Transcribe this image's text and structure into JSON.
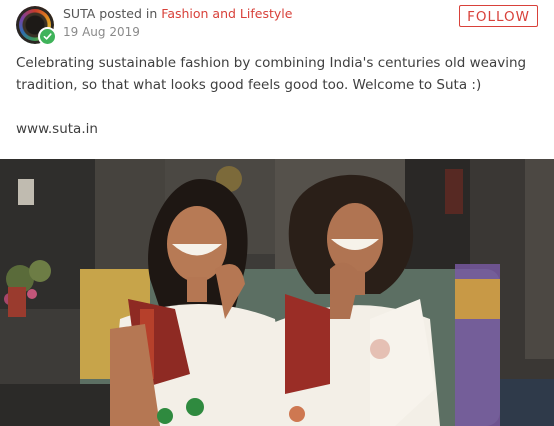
{
  "post": {
    "author": "SUTA",
    "posted_in": "posted in",
    "category": "Fashion and Lifestyle",
    "date": "19 Aug 2019",
    "follow_label": "FOLLOW",
    "description": "Celebrating sustainable fashion by combining India's centuries old weaving tradition, so that what looks good feels good too. Welcome to Suta :)",
    "website": "www.suta.in"
  },
  "colors": {
    "accent": "#d8413a",
    "verified": "#3fb35a",
    "text": "#3f3f3f",
    "muted": "#8a8a8a"
  },
  "icons": {
    "verified": "check-icon"
  }
}
